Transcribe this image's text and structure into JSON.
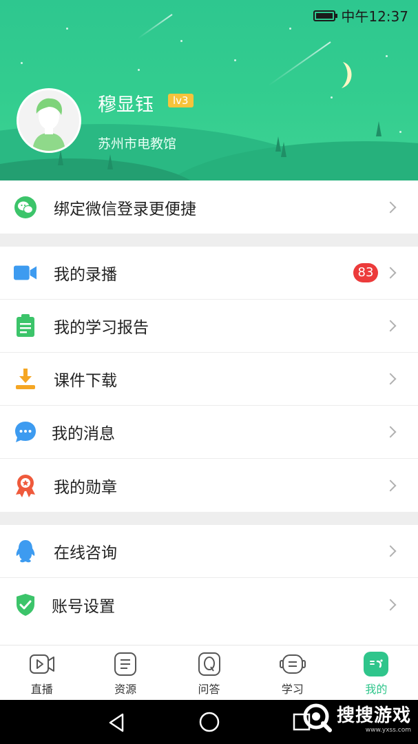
{
  "status_bar": {
    "time": "中午12:37"
  },
  "profile": {
    "name": "穆显钰",
    "level": "lv3",
    "organization": "苏州市电教馆"
  },
  "wechat_section": {
    "items": [
      {
        "label": "绑定微信登录更便捷",
        "icon": "wechat-icon"
      }
    ]
  },
  "main_section": {
    "items": [
      {
        "label": "我的录播",
        "icon": "video-camera-icon",
        "badge": "83"
      },
      {
        "label": "我的学习报告",
        "icon": "clipboard-icon"
      },
      {
        "label": "课件下载",
        "icon": "download-icon"
      },
      {
        "label": "我的消息",
        "icon": "chat-bubble-icon"
      },
      {
        "label": "我的勋章",
        "icon": "medal-icon"
      }
    ]
  },
  "support_section": {
    "items": [
      {
        "label": "在线咨询",
        "icon": "qq-penguin-icon"
      },
      {
        "label": "账号设置",
        "icon": "shield-check-icon"
      }
    ]
  },
  "bottom_nav": {
    "items": [
      {
        "label": "直播",
        "icon": "live-video-icon"
      },
      {
        "label": "资源",
        "icon": "document-icon"
      },
      {
        "label": "问答",
        "icon": "question-icon"
      },
      {
        "label": "学习",
        "icon": "robot-face-icon"
      },
      {
        "label": "我的",
        "icon": "smile-face-icon",
        "active": true
      }
    ]
  },
  "watermark": {
    "text": "搜搜游戏",
    "url": "www.yxss.com"
  },
  "colors": {
    "accent": "#2fc58b",
    "badge": "#ec3b3b",
    "level": "#f6c33b"
  }
}
